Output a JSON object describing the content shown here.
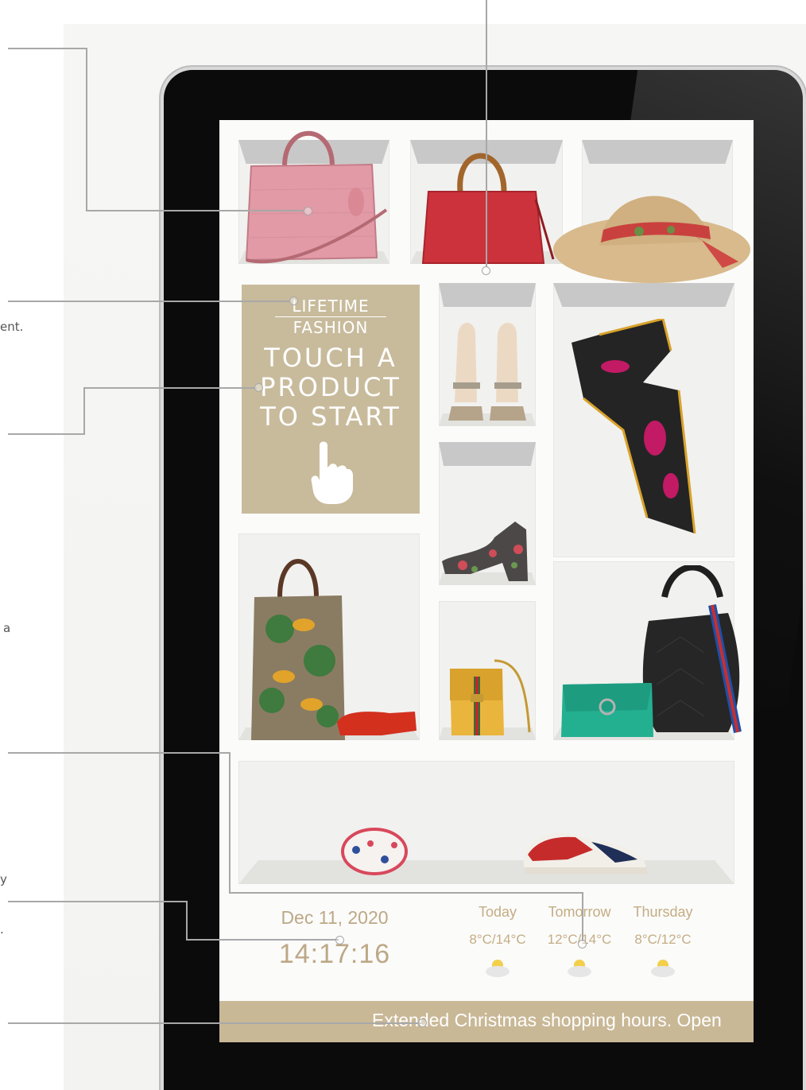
{
  "callouts": [
    "ent.",
    "a",
    "y",
    "."
  ],
  "promo": {
    "brand_line1": "LIFETIME",
    "brand_line2": "FASHION",
    "cta_line1": "TOUCH A",
    "cta_line2": "PRODUCT",
    "cta_line3": "TO START",
    "icon": "touch-hand-icon"
  },
  "clock": {
    "date": "Dec 11, 2020",
    "time": "14:17:16"
  },
  "weather": [
    {
      "day": "Today",
      "temp": "8°C/14°C",
      "icon": "partly-sunny-icon"
    },
    {
      "day": "Tomorrow",
      "temp": "12°C/14°C",
      "icon": "partly-sunny-icon"
    },
    {
      "day": "Thursday",
      "temp": "8°C/12°C",
      "icon": "partly-sunny-icon"
    }
  ],
  "ticker": {
    "text": "Extended Christmas shopping hours. Open"
  },
  "products": [
    {
      "name": "pink-handbag",
      "color": "#e29aa5"
    },
    {
      "name": "red-handbag",
      "color": "#c9313a"
    },
    {
      "name": "straw-hat",
      "color": "#d7b98a"
    },
    {
      "name": "platform-sandals",
      "color": "#c7b49a"
    },
    {
      "name": "silk-scarf",
      "color": "#2a2a2a"
    },
    {
      "name": "floral-heels",
      "color": "#4c4848"
    },
    {
      "name": "tiger-tote",
      "color": "#8a7a5e"
    },
    {
      "name": "red-gloves",
      "color": "#d2311f"
    },
    {
      "name": "yellow-shoulder-bag",
      "color": "#eab53d"
    },
    {
      "name": "green-mini-bag",
      "color": "#23b091"
    },
    {
      "name": "black-hobo-bag",
      "color": "#232323"
    },
    {
      "name": "printed-bangle",
      "color": "#d8485b"
    },
    {
      "name": "sneakers",
      "color": "#c62b2b"
    }
  ],
  "colors": {
    "accent": "#c9b896",
    "text_gold": "#bda886",
    "bezel": "#0b0b0b"
  }
}
